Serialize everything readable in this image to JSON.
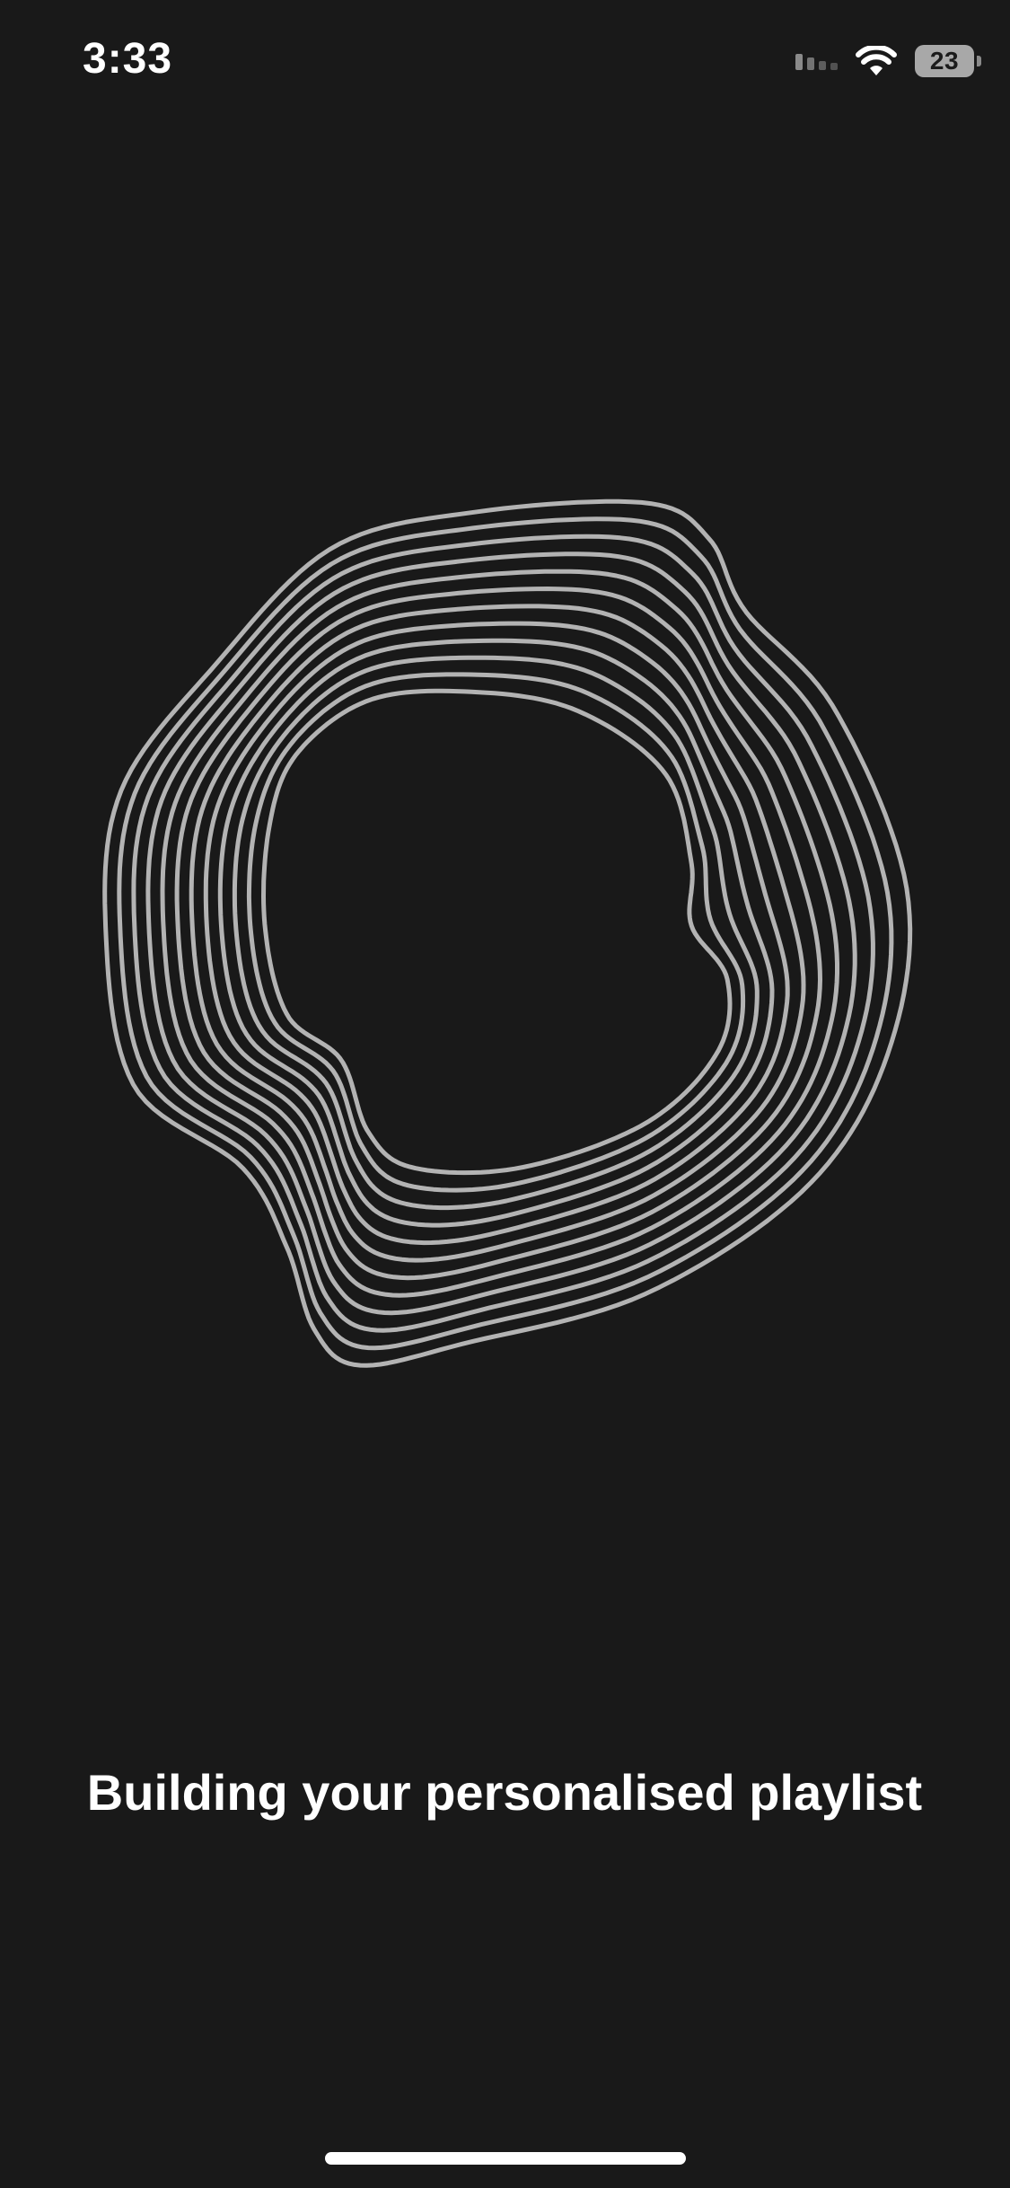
{
  "status_bar": {
    "time": "3:33",
    "battery_level": "23",
    "icons": [
      "signal-icon",
      "wifi-icon",
      "battery-icon"
    ]
  },
  "loading_screen": {
    "message": "Building your personalised playlist",
    "artwork": "concentric-wave-rings",
    "ring_color": "#b3b3b3",
    "background_color": "#191919"
  }
}
